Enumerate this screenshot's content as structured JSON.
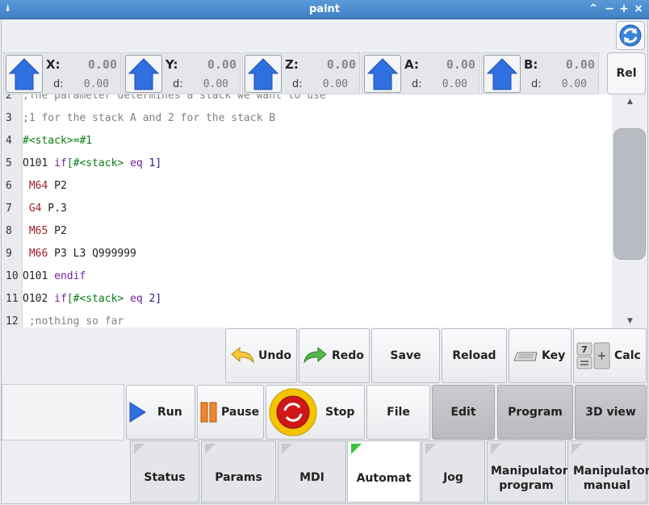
{
  "window": {
    "title": "paint",
    "menu_glyph": "⯯",
    "controls": [
      "⌃",
      "−",
      "+",
      "×"
    ]
  },
  "axes": [
    {
      "label": "X:",
      "value": "0.00",
      "d_label": "d:",
      "d_value": "0.00"
    },
    {
      "label": "Y:",
      "value": "0.00",
      "d_label": "d:",
      "d_value": "0.00"
    },
    {
      "label": "Z:",
      "value": "0.00",
      "d_label": "d:",
      "d_value": "0.00"
    },
    {
      "label": "A:",
      "value": "0.00",
      "d_label": "d:",
      "d_value": "0.00"
    },
    {
      "label": "B:",
      "value": "0.00",
      "d_label": "d:",
      "d_value": "0.00"
    }
  ],
  "rel_label": "Rel",
  "editor": {
    "lines": [
      {
        "n": "2",
        "segs": [
          {
            "t": ";The parameter determines a stack we want to use",
            "c": "comment"
          }
        ]
      },
      {
        "n": "3",
        "segs": [
          {
            "t": ";1 for the stack A and 2 for the stack B",
            "c": "comment"
          }
        ]
      },
      {
        "n": "4",
        "segs": [
          {
            "t": "#<stack>=#1",
            "c": "green"
          }
        ]
      },
      {
        "n": "5",
        "segs": [
          {
            "t": "O101 ",
            "c": "plain"
          },
          {
            "t": "if",
            "c": "kw"
          },
          {
            "t": "[#<stack> ",
            "c": "green"
          },
          {
            "t": "eq",
            "c": "kw"
          },
          {
            "t": " 1]",
            "c": "num"
          }
        ]
      },
      {
        "n": "6",
        "segs": [
          {
            "t": " M64",
            "c": "m"
          },
          {
            "t": " P2",
            "c": "plain"
          }
        ]
      },
      {
        "n": "7",
        "segs": [
          {
            "t": " G4",
            "c": "m"
          },
          {
            "t": " P.3",
            "c": "plain"
          }
        ]
      },
      {
        "n": "8",
        "segs": [
          {
            "t": " M65",
            "c": "m"
          },
          {
            "t": " P2",
            "c": "plain"
          }
        ]
      },
      {
        "n": "9",
        "segs": [
          {
            "t": " M66",
            "c": "m"
          },
          {
            "t": " P3 L3 Q999999",
            "c": "plain"
          }
        ]
      },
      {
        "n": "10",
        "segs": [
          {
            "t": "O101 ",
            "c": "plain"
          },
          {
            "t": "endif",
            "c": "kw"
          }
        ]
      },
      {
        "n": "11",
        "segs": [
          {
            "t": "O102 ",
            "c": "plain"
          },
          {
            "t": "if",
            "c": "kw"
          },
          {
            "t": "[#<stack> ",
            "c": "green"
          },
          {
            "t": "eq",
            "c": "kw"
          },
          {
            "t": " 2]",
            "c": "num"
          }
        ]
      },
      {
        "n": "12",
        "segs": [
          {
            "t": " ;nothing so far",
            "c": "comment"
          }
        ]
      }
    ]
  },
  "edit_toolbar": {
    "undo": "Undo",
    "redo": "Redo",
    "save": "Save",
    "reload": "Reload",
    "key": "Key",
    "calc": "Calc",
    "calc_digit": "7"
  },
  "run_toolbar": {
    "run": "Run",
    "pause": "Pause",
    "stop": "Stop",
    "file": "File",
    "edit": "Edit",
    "program": "Program",
    "view3d": "3D view"
  },
  "tabs": [
    {
      "label": "Status",
      "active": false
    },
    {
      "label": "Params",
      "active": false
    },
    {
      "label": "MDI",
      "active": false
    },
    {
      "label": "Automat",
      "active": true
    },
    {
      "label": "Jog",
      "active": false
    },
    {
      "label": "Manipulator program",
      "active": false
    },
    {
      "label": "Manipulator manual",
      "active": false
    }
  ],
  "colors": {
    "titlebar": "#4a8ccf",
    "home_icon": "#2f6fe0",
    "stop_ring": "#f5c400",
    "stop_core": "#d01818",
    "tab_active_marker": "#3cc43c"
  }
}
